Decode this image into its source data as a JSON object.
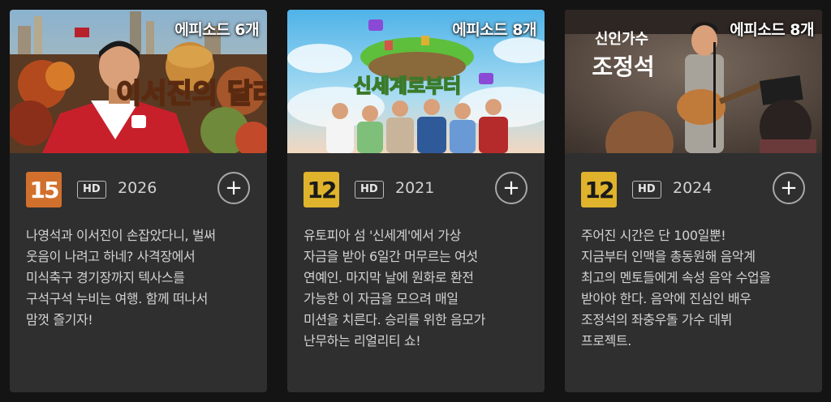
{
  "cards": [
    {
      "episodes": "에피소드 6개",
      "rating": "15",
      "rating_color": "#d1702d",
      "quality": "HD",
      "year": "2026",
      "add_icon": "plus-icon",
      "thumbnail_title": "이서진의 달라달라",
      "description": "나영석과 이서진이 손잡았다니, 벌써\n웃음이 나려고 하네? 사격장에서\n미식축구 경기장까지 텍사스를\n구석구석 누비는 여행. 함께 떠나서\n맘껏 즐기자!"
    },
    {
      "episodes": "에피소드 8개",
      "rating": "12",
      "rating_color": "#e0b32c",
      "quality": "HD",
      "year": "2021",
      "add_icon": "plus-icon",
      "thumbnail_title": "신세계로부터",
      "description": "유토피아 섬 '신세계'에서 가상\n자금을 받아 6일간 머무르는 여섯\n연예인. 마지막 날에 원화로 환전\n가능한 이 자금을 모으려 매일\n미션을 치른다. 승리를 위한 음모가\n난무하는 리얼리티 쇼!"
    },
    {
      "episodes": "에피소드 8개",
      "rating": "12",
      "rating_color": "#e0b32c",
      "quality": "HD",
      "year": "2024",
      "add_icon": "plus-icon",
      "thumbnail_title_top": "신인가수",
      "thumbnail_title": "조정석",
      "description": "주어진 시간은 단 100일뿐!\n지금부터 인맥을 총동원해 음악계\n최고의 멘토들에게 속성 음악 수업을\n받아야 한다. 음악에 진심인 배우\n조정석의 좌충우돌 가수 데뷔\n프로젝트."
    }
  ]
}
